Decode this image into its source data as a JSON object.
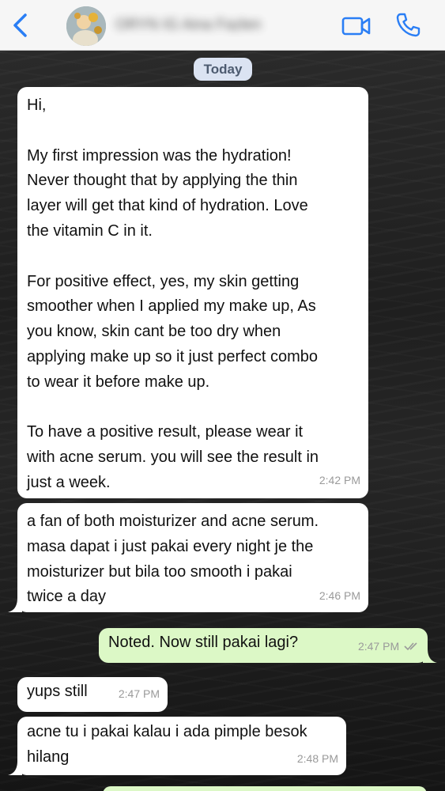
{
  "header": {
    "contact_name": "ORYN IG Aina Fazlen",
    "back_icon": "chevron-left-icon",
    "video_icon": "video-camera-icon",
    "call_icon": "phone-icon",
    "accent_color": "#2a7ef5"
  },
  "date_label": "Today",
  "messages": [
    {
      "direction": "incoming",
      "text": "Hi,\n\nMy first impression was the hydration!\nNever thought that by applying the thin\nlayer will get that kind of hydration. Love\nthe vitamin C in it.\n\nFor positive effect, yes, my skin getting\nsmoother when I applied my make up, As\nyou know, skin cant be too dry when\napplying make up so it just perfect combo\nto wear it before make up.\n\nTo have a positive result, please wear it\nwith acne serum. you will see the result in\njust a week.",
      "time": "2:42 PM"
    },
    {
      "direction": "incoming",
      "text": "a fan of both moisturizer and acne serum.\nmasa dapat i just pakai every night je the\nmoisturizer but bila too smooth i pakai\ntwice a day",
      "time": "2:46 PM"
    },
    {
      "direction": "outgoing",
      "text": "Noted. Now still pakai lagi?",
      "time": "2:47 PM",
      "status_icon": "double-check-icon"
    },
    {
      "direction": "incoming",
      "text": "yups still",
      "time": "2:47 PM"
    },
    {
      "direction": "incoming",
      "text": "acne tu i pakai kalau i ada pimple besok\nhilang",
      "time": "2:48 PM"
    }
  ],
  "colors": {
    "incoming_bubble": "#ffffff",
    "outgoing_bubble": "#dcf8c6",
    "date_pill": "#dbe3f2"
  }
}
